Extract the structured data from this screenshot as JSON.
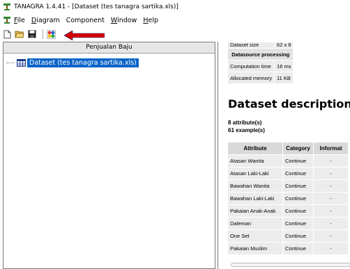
{
  "window": {
    "title": "TANAGRA 1.4.41 - [Dataset (tes tanagra sartika.xls)]"
  },
  "menu": [
    {
      "label_pre": "",
      "accel": "F",
      "label_post": "ile"
    },
    {
      "label_pre": "",
      "accel": "D",
      "label_post": "iagram"
    },
    {
      "label_pre": "Component",
      "accel": "",
      "label_post": ""
    },
    {
      "label_pre": "",
      "accel": "W",
      "label_post": "indow"
    },
    {
      "label_pre": "",
      "accel": "H",
      "label_post": "elp"
    }
  ],
  "toolbar": {
    "icons": [
      "new-file-icon",
      "open-folder-icon",
      "save-disk-icon",
      "component-icon"
    ],
    "arrow_color": "#d40000"
  },
  "left_pane": {
    "header": "Penjualan Baju",
    "tree_item": "Dataset (tes tanagra sartika.xls)",
    "selection_color": "#0a64c8"
  },
  "info": {
    "rows": [
      {
        "label": "Dataset size",
        "value": "62 x 8"
      },
      {
        "section": "Datasource processing"
      },
      {
        "label": "Computation time",
        "value": "16 ms"
      },
      {
        "label": "Allocated memory",
        "value": "11 KB"
      }
    ]
  },
  "description": {
    "heading": "Dataset description",
    "attributes": "8 attribute(s)",
    "examples": "61 example(s)"
  },
  "attr_table": {
    "headers": [
      "Attribute",
      "Category",
      "Informat"
    ],
    "rows": [
      [
        "Atasan Wanita",
        "Continue",
        "-"
      ],
      [
        "Atasan Laki-Laki",
        "Continue",
        "-"
      ],
      [
        "Bawahan Wanita",
        "Continue",
        "-"
      ],
      [
        "Bawahan Laki-Laki",
        "Continue",
        "-"
      ],
      [
        "Pakaian Anak-Anak",
        "Continue",
        "-"
      ],
      [
        "Daleman",
        "Continue",
        "-"
      ],
      [
        "One Set",
        "Continue",
        "-"
      ],
      [
        "Pakaian Muslim",
        "Continue",
        "-"
      ]
    ]
  }
}
